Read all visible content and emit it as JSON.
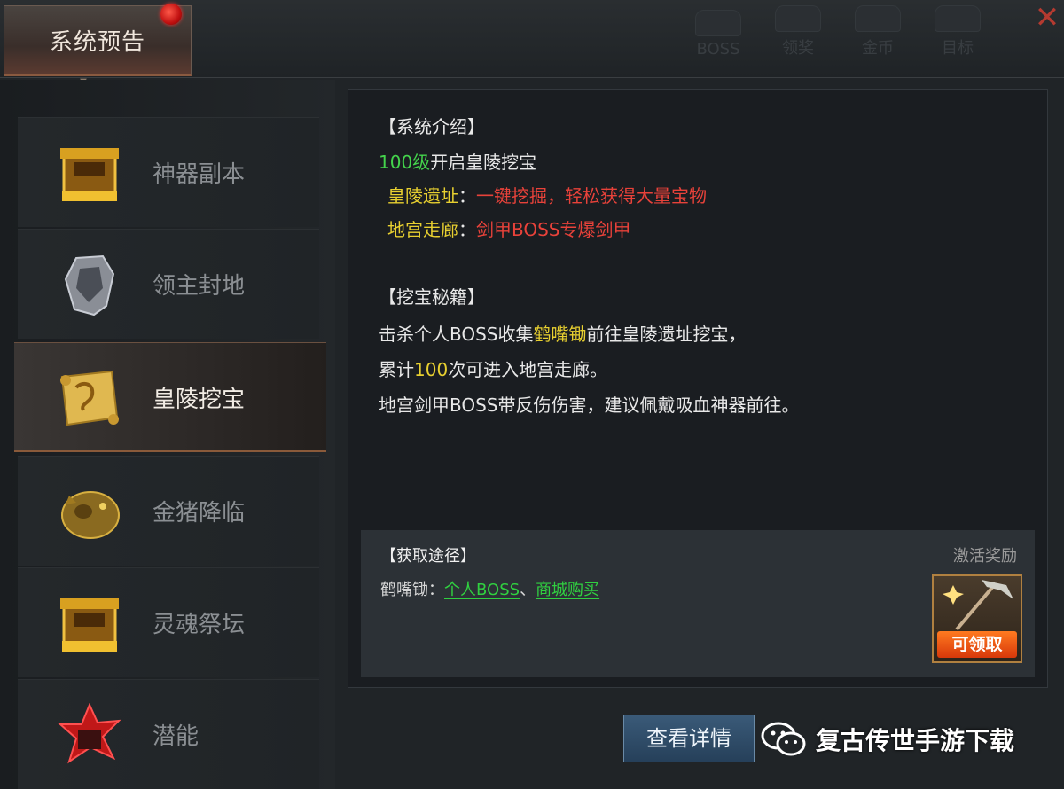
{
  "window": {
    "title": "系统预告"
  },
  "top_icons": [
    {
      "label": "BOSS",
      "icon": "boss-icon"
    },
    {
      "label": "领奖",
      "icon": "reward-icon"
    },
    {
      "label": "金币",
      "icon": "coin-icon"
    },
    {
      "label": "目标",
      "icon": "target-icon"
    }
  ],
  "sidebar": {
    "items": [
      {
        "label": "神器副本",
        "icon": "artifact-dungeon-icon",
        "active": false
      },
      {
        "label": "领主封地",
        "icon": "lord-armor-icon",
        "active": false
      },
      {
        "label": "皇陵挖宝",
        "icon": "treasure-scroll-icon",
        "active": true
      },
      {
        "label": "金猪降临",
        "icon": "golden-pig-icon",
        "active": false
      },
      {
        "label": "灵魂祭坛",
        "icon": "soul-altar-icon",
        "active": false
      },
      {
        "label": "潜能",
        "icon": "potential-icon",
        "active": false
      }
    ]
  },
  "content": {
    "intro_heading": "【系统介绍】",
    "intro_level": "100级",
    "intro_text": "开启皇陵挖宝",
    "site_name": "皇陵遗址",
    "site_sep": "：",
    "site_desc": "一键挖掘，轻松获得大量宝物",
    "palace_name": "地宫走廊",
    "palace_sep": "：",
    "palace_desc": "剑甲BOSS专爆剑甲",
    "tips_heading": "【挖宝秘籍】",
    "tip1_a": "击杀个人BOSS收集",
    "tip1_item": "鹤嘴锄",
    "tip1_b": "前往皇陵遗址挖宝，",
    "tip2_a": "累计",
    "tip2_num": "100",
    "tip2_b": "次可进入地宫走廊。",
    "tip3": "地宫剑甲BOSS带反伤伤害，建议佩戴吸血神器前往。"
  },
  "acquire": {
    "heading": "【获取途径】",
    "item": "鹤嘴锄：",
    "link1": "个人BOSS",
    "sep": "、",
    "link2": "商城购买",
    "reward_label": "激活奖励",
    "reward_button": "可领取",
    "reward_icon": "pickaxe-icon"
  },
  "detail_button": "查看详情",
  "watermark": {
    "text": "复古传世手游下载",
    "icon": "wechat-icon"
  },
  "colors": {
    "gold": "#e8d030",
    "green": "#44d44c",
    "red": "#e8423a",
    "accent_orange": "#ff7a20"
  }
}
